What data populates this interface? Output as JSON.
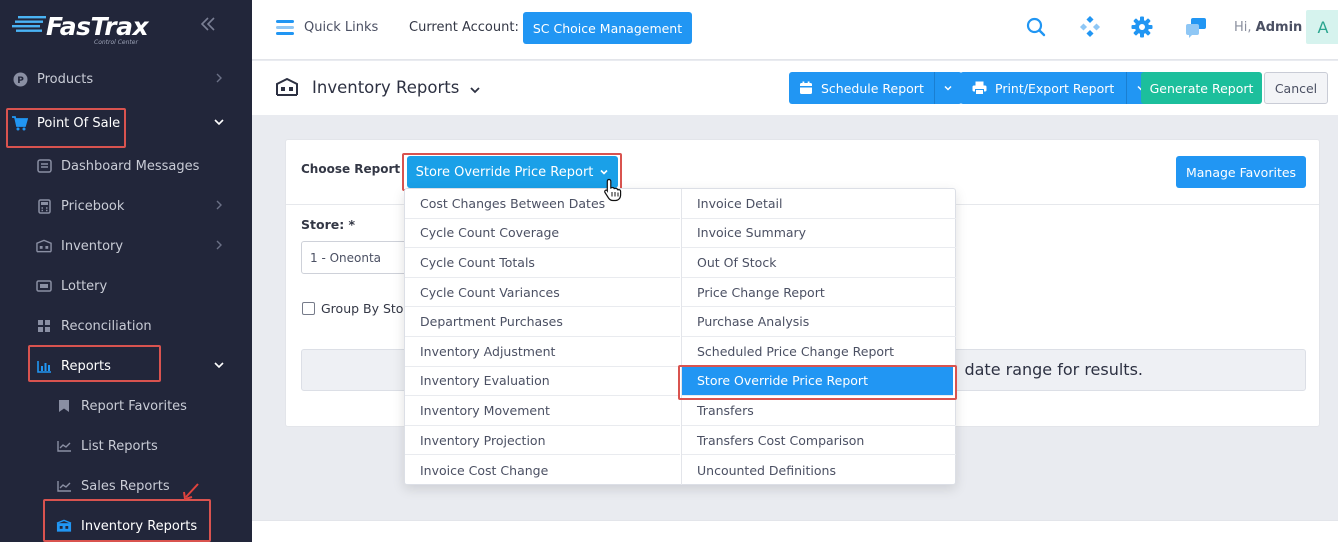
{
  "brand": {
    "name": "FasTrax",
    "tagline": "Control Center"
  },
  "sidebar": {
    "items": [
      {
        "label": "Products"
      },
      {
        "label": "Point Of Sale"
      },
      {
        "label": "Dashboard Messages"
      },
      {
        "label": "Pricebook"
      },
      {
        "label": "Inventory"
      },
      {
        "label": "Lottery"
      },
      {
        "label": "Reconciliation"
      },
      {
        "label": "Reports"
      },
      {
        "label": "Report Favorites"
      },
      {
        "label": "List Reports"
      },
      {
        "label": "Sales Reports"
      },
      {
        "label": "Inventory Reports"
      }
    ]
  },
  "topbar": {
    "quick_links": "Quick Links",
    "current_account_label": "Current Account:",
    "current_account": "SC Choice Management",
    "greeting": "Hi,",
    "user": "Admin",
    "avatar_initial": "A"
  },
  "header": {
    "title": "Inventory Reports",
    "schedule_report": "Schedule Report",
    "print_export": "Print/Export Report",
    "generate_report": "Generate Report",
    "cancel": "Cancel"
  },
  "card": {
    "choose_report_label": "Choose Report",
    "selected_report": "Store Override Price Report",
    "manage_favorites": "Manage Favorites",
    "store_label": "Store: *",
    "store_value": "1 - Oneonta",
    "group_by_label": "Group By Store",
    "message": "date range for results."
  },
  "dropdown": {
    "left": [
      "Cost Changes Between Dates",
      "Cycle Count Coverage",
      "Cycle Count Totals",
      "Cycle Count Variances",
      "Department Purchases",
      "Inventory Adjustment",
      "Inventory Evaluation",
      "Inventory Movement",
      "Inventory Projection",
      "Invoice Cost Change"
    ],
    "right": [
      "Invoice Detail",
      "Invoice Summary",
      "Out Of Stock",
      "Price Change Report",
      "Purchase Analysis",
      "Scheduled Price Change Report",
      "Store Override Price Report",
      "Transfers",
      "Transfers Cost Comparison",
      "Uncounted Definitions"
    ]
  },
  "colors": {
    "sidebar_bg": "#22263a",
    "primary": "#2196f3",
    "success": "#1cbf9c",
    "highlight": "#d9534f"
  }
}
